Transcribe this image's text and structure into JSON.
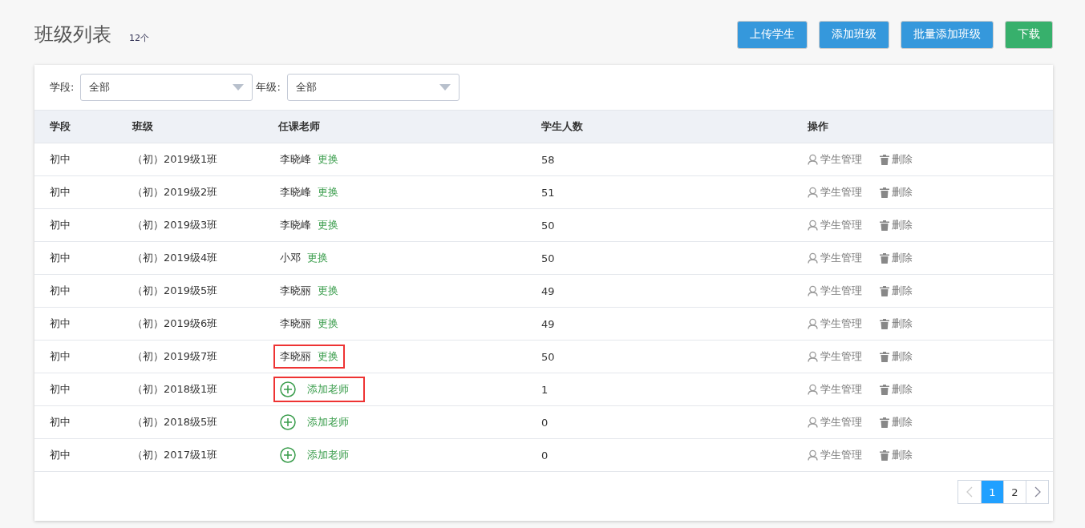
{
  "page": {
    "title": "班级列表",
    "count": "12个"
  },
  "buttons": [
    {
      "label": "上传学生",
      "kind": "primary"
    },
    {
      "label": "添加班级",
      "kind": "primary"
    },
    {
      "label": "批量添加班级",
      "kind": "primary"
    },
    {
      "label": "下载",
      "kind": "success"
    }
  ],
  "filters": [
    {
      "label": "学段:",
      "value": "全部"
    },
    {
      "label": "年级:",
      "value": "全部"
    }
  ],
  "table": {
    "columns": [
      "学段",
      "班级",
      "任课老师",
      "学生人数",
      "操作"
    ],
    "rows": [
      {
        "stage": "初中",
        "class": "（初）2019级1班",
        "teacher": {
          "kind": "assigned",
          "name": "李晓峰",
          "action": "更换",
          "highlighted": false
        },
        "students": "58",
        "actions": [
          "学生管理",
          "删除"
        ]
      },
      {
        "stage": "初中",
        "class": "（初）2019级2班",
        "teacher": {
          "kind": "assigned",
          "name": "李晓峰",
          "action": "更换",
          "highlighted": false
        },
        "students": "51",
        "actions": [
          "学生管理",
          "删除"
        ]
      },
      {
        "stage": "初中",
        "class": "（初）2019级3班",
        "teacher": {
          "kind": "assigned",
          "name": "李晓峰",
          "action": "更换",
          "highlighted": false
        },
        "students": "50",
        "actions": [
          "学生管理",
          "删除"
        ]
      },
      {
        "stage": "初中",
        "class": "（初）2019级4班",
        "teacher": {
          "kind": "assigned",
          "name": "小邓",
          "action": "更换",
          "highlighted": false
        },
        "students": "50",
        "actions": [
          "学生管理",
          "删除"
        ]
      },
      {
        "stage": "初中",
        "class": "（初）2019级5班",
        "teacher": {
          "kind": "assigned",
          "name": "李晓丽",
          "action": "更换",
          "highlighted": false
        },
        "students": "49",
        "actions": [
          "学生管理",
          "删除"
        ]
      },
      {
        "stage": "初中",
        "class": "（初）2019级6班",
        "teacher": {
          "kind": "assigned",
          "name": "李晓丽",
          "action": "更换",
          "highlighted": false
        },
        "students": "49",
        "actions": [
          "学生管理",
          "删除"
        ]
      },
      {
        "stage": "初中",
        "class": "（初）2019级7班",
        "teacher": {
          "kind": "assigned",
          "name": "李晓丽",
          "action": "更换",
          "highlighted": true
        },
        "students": "50",
        "actions": [
          "学生管理",
          "删除"
        ]
      },
      {
        "stage": "初中",
        "class": "（初）2018级1班",
        "teacher": {
          "kind": "empty",
          "action": "添加老师",
          "highlighted": true
        },
        "students": "1",
        "actions": [
          "学生管理",
          "删除"
        ]
      },
      {
        "stage": "初中",
        "class": "（初）2018级5班",
        "teacher": {
          "kind": "empty",
          "action": "添加老师",
          "highlighted": false
        },
        "students": "0",
        "actions": [
          "学生管理",
          "删除"
        ]
      },
      {
        "stage": "初中",
        "class": "（初）2017级1班",
        "teacher": {
          "kind": "empty",
          "action": "添加老师",
          "highlighted": false
        },
        "students": "0",
        "actions": [
          "学生管理",
          "删除"
        ]
      }
    ]
  },
  "pagination": {
    "pages": [
      {
        "label": "1",
        "selected": true
      },
      {
        "label": "2",
        "selected": false
      }
    ]
  }
}
